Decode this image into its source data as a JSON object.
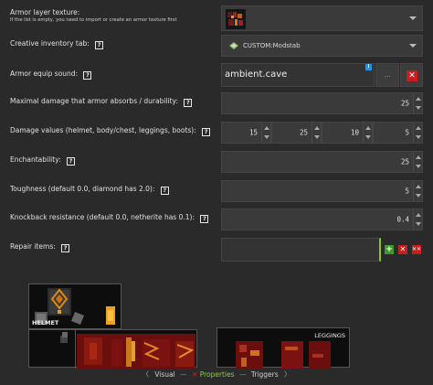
{
  "fields": {
    "armor_texture": {
      "label": "Armor layer texture:",
      "sublabel": "If the list is empty, you need to import or create an armor texture first"
    },
    "creative_tab": {
      "label": "Creative inventory tab:",
      "value": "CUSTOM:Modstab"
    },
    "equip_sound": {
      "label": "Armor equip sound:",
      "value": "ambient.cave",
      "info_badge": "i",
      "browse_label": "..."
    },
    "max_damage": {
      "label": "Maximal damage that armor absorbs / durability:",
      "value": "25"
    },
    "damage_values": {
      "label": "Damage values (helmet, body/chest, leggings, boots):",
      "values": [
        "15",
        "25",
        "10",
        "5"
      ]
    },
    "enchantability": {
      "label": "Enchantability:",
      "value": "25"
    },
    "toughness": {
      "label": "Toughness (default 0.0, diamond has 2.0):",
      "value": "5"
    },
    "knockback": {
      "label": "Knockback resistance (default 0.0, netherite has 0.1):",
      "value": "0.4"
    },
    "repair_items": {
      "label": "Repair items:"
    }
  },
  "help_symbol": "?",
  "preview": {
    "helmet_label": "HELMET",
    "leggings_label": "LEGGINGS"
  },
  "bottom_nav": {
    "visual": "Visual",
    "properties": "Properties",
    "triggers": "Triggers"
  },
  "colors": {
    "background": "#2a2a2a",
    "field": "#3a3a3a",
    "accent_green": "#3e9c2a",
    "accent_red": "#c81e1e",
    "properties_text": "#88cc44"
  }
}
